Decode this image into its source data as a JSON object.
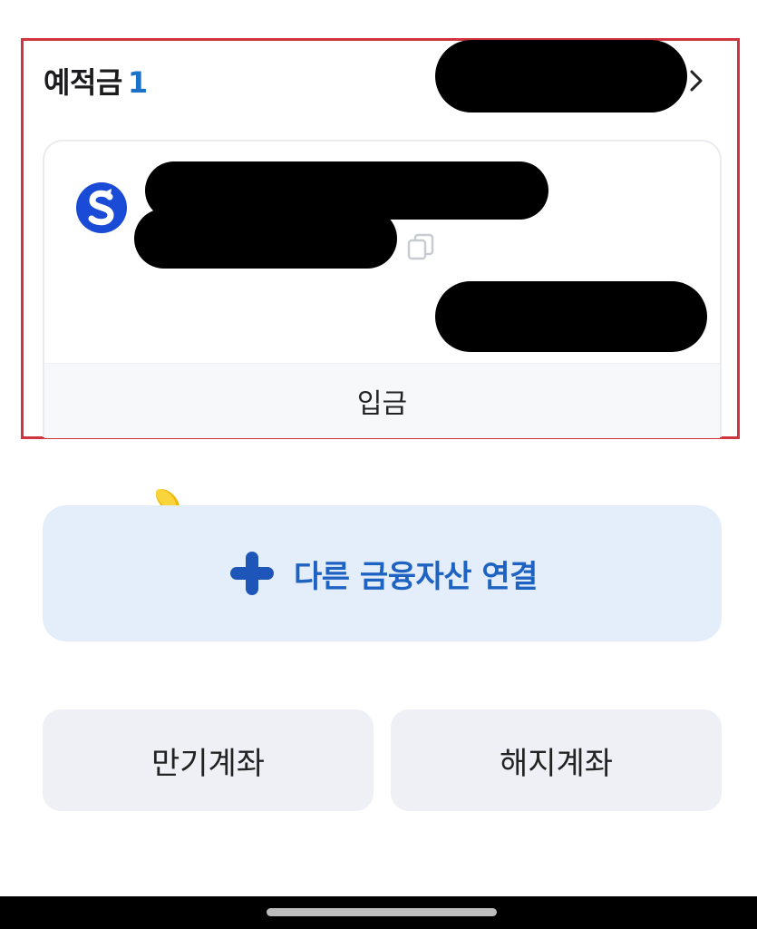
{
  "deposit_section": {
    "title": "예적금",
    "count": "1",
    "account_card": {
      "bank_icon": "shinhan-bank-logo-icon",
      "deposit_label": "입금"
    }
  },
  "connect_button": {
    "label": "다른 금융자산 연결",
    "icon": "plus-icon"
  },
  "bottom_buttons": {
    "matured_label": "만기계좌",
    "closed_label": "해지계좌"
  },
  "colors": {
    "highlight_border": "#d0343f",
    "accent_blue": "#1e63c1",
    "connect_bg": "#e3eefa",
    "coin": "#f4c20d"
  }
}
